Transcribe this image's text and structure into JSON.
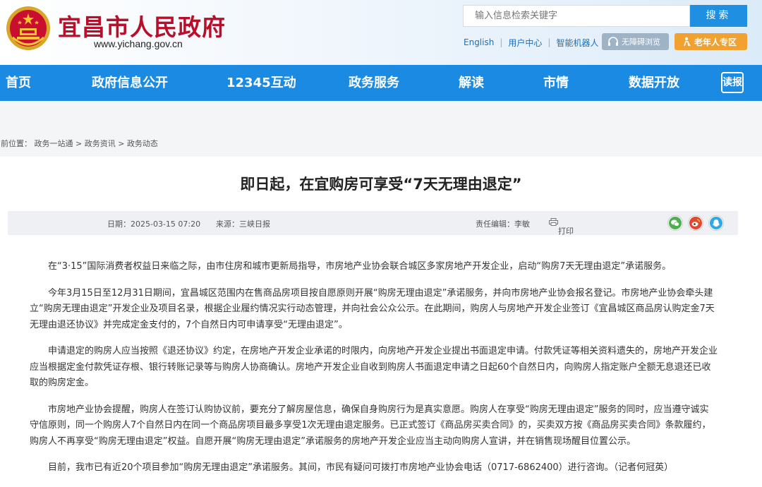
{
  "header": {
    "site_name": "宜昌市人民政府",
    "site_url": "www.yichang.gov.cn",
    "search_placeholder": "输入信息检索关键字",
    "search_button": "搜索",
    "links": [
      "English",
      "用户中心",
      "智能机器人"
    ],
    "accessibility_label": "无障碍浏览",
    "elder_label": "老年人专区",
    "emblem_color": "#c8102e",
    "elder_color": "#f0a130"
  },
  "nav": {
    "items": [
      "首页",
      "政府信息公开",
      "12345互动",
      "政务服务",
      "解读",
      "市情",
      "数据开放"
    ],
    "read_label": "读报",
    "color": "#1a8ae3"
  },
  "breadcrumb": {
    "label": "当前位置：",
    "items": [
      "政务一站通",
      "政务资讯",
      "政务动态"
    ]
  },
  "article": {
    "title": "即日起，在宜购房可享受“7天无理由退定”",
    "date": "日期：2025-03-15 07:20",
    "source": "来源：三峡日报",
    "editor": "责任编辑：李敏",
    "print": "打印",
    "paragraphs": [
      "在“3·15”国际消费者权益日来临之际，由市住房和城市更新局指导，市房地产业协会联合城区多家房地产开发企业，启动“购房7天无理由退定”承诺服务。",
      "今年3月15日至12月31日期间，宜昌城区范围内在售商品房项目按自愿原则开展“购房无理由退定”承诺服务，并向市房地产业协会报名登记。市房地产业协会牵头建立“购房无理由退定”开发企业及项目名录，根据企业履约情况实行动态管理，并向社会公众公示。在此期间，购房人与房地产开发企业签订《宜昌城区商品房认购定金7天无理由退还协议》并完成定金支付的，7个自然日内可申请享受“无理由退定”。",
      "申请退定的购房人应当按照《退还协议》约定，在房地产开发企业承诺的时限内，向房地产开发企业提出书面退定申请。付款凭证等相关资料遗失的，房地产开发企业应当根据定金付款凭证存根、银行转账记录等与购房人协商确认。房地产开发企业自收到购房人书面退定申请之日起60个自然日内，向购房人指定账户全额无息退还已收取的购房定金。",
      "市房地产业协会提醒，购房人在签订认购协议前，要充分了解房屋信息，确保自身购房行为是真实意愿。购房人在享受“购房无理由退定”服务的同时，应当遵守诚实守信原则，同一个购房人7个自然日内在同一个商品房项目最多享受1次无理由退定服务。已正式签订《商品房买卖合同》的，买卖双方按《商品房买卖合同》条款履约，购房人不再享受“购房无理由退定”权益。自愿开展“购房无理由退定”承诺服务的房地产开发企业应当主动向购房人宣讲，并在销售现场醒目位置公示。",
      "目前，我市已有近20个项目参加“购房无理由退定”承诺服务。其间，市民有疑问可拨打市房地产业协会电话（0717-6862400）进行咨询。（记者何冠英）"
    ]
  }
}
